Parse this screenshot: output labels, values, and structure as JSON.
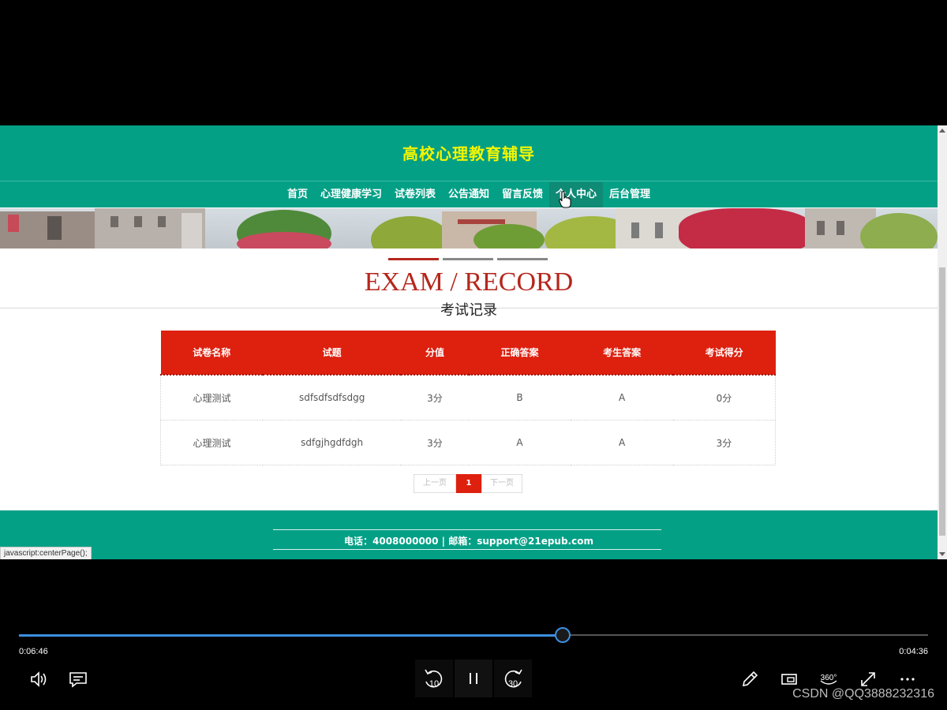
{
  "site": {
    "title": "高校心理教育辅导",
    "nav": [
      "首页",
      "心理健康学习",
      "试卷列表",
      "公告通知",
      "留言反馈",
      "个人中心",
      "后台管理"
    ],
    "active_nav_index": 5
  },
  "section": {
    "title_en": "EXAM / RECORD",
    "title_cn": "考试记录"
  },
  "table": {
    "headers": [
      "试卷名称",
      "试题",
      "分值",
      "正确答案",
      "考生答案",
      "考试得分"
    ],
    "rows": [
      [
        "心理测试",
        "sdfsdfsdfsdgg",
        "3分",
        "B",
        "A",
        "0分"
      ],
      [
        "心理测试",
        "sdfgjhgdfdgh",
        "3分",
        "A",
        "A",
        "3分"
      ]
    ]
  },
  "pagination": {
    "prev_label": "上一页",
    "current_page": "1",
    "next_label": "下一页"
  },
  "footer": {
    "contact": "电话：4008000000 | 邮箱：support@21epub.com"
  },
  "status_bar": {
    "url": "javascript:centerPage();"
  },
  "player": {
    "elapsed": "0:06:46",
    "total": "0:04:36",
    "progress_fraction": 0.597,
    "rewind_seconds": "10",
    "forward_seconds": "30",
    "vr_label": "360°"
  },
  "watermark": "CSDN @QQ3888232316",
  "colors": {
    "header_bg": "#04a086",
    "title_yellow": "#f5f500",
    "accent_red": "#de200f",
    "section_title_red": "#b5271c",
    "progress_blue": "#3d8fe0"
  },
  "icons": [
    "volume-icon",
    "captions-icon",
    "rewind-icon",
    "pause-icon",
    "forward-icon",
    "pen-icon",
    "mini-player-icon",
    "vr-360-icon",
    "fullscreen-icon",
    "more-icon",
    "hand-cursor-icon"
  ]
}
